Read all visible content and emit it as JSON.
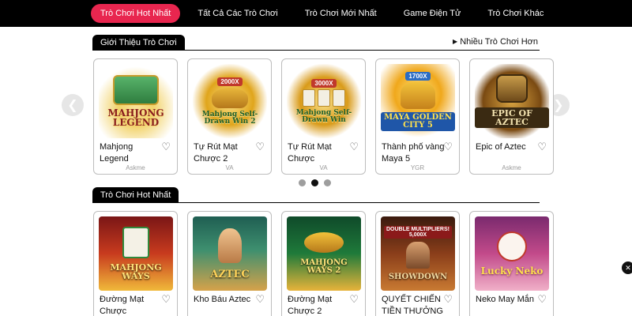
{
  "nav": {
    "items": [
      {
        "label": "Trò Chơi Hot Nhất",
        "active": true
      },
      {
        "label": "Tất Cả Các Trò Chơi",
        "active": false
      },
      {
        "label": "Trò Chơi Mới Nhất",
        "active": false
      },
      {
        "label": "Game Điện Tử",
        "active": false
      },
      {
        "label": "Trò Chơi Khác",
        "active": false
      }
    ]
  },
  "intro": {
    "title": "Giới Thiệu Trò Chơi",
    "more_label": "Nhiều Trò Chơi Hơn",
    "games": [
      {
        "name": "Mahjong Legend",
        "provider": "Askme",
        "art": "MAHJONG LEGEND"
      },
      {
        "name": "Tự Rút Mạt Chược 2",
        "provider": "VA",
        "art": "Mahjong Self-Drawn Win 2",
        "badge": "2000X"
      },
      {
        "name": "Tự Rút Mạt Chược",
        "provider": "VA",
        "art": "Mahjong Self-Drawn Win",
        "badge": "3000X"
      },
      {
        "name": "Thành phố vàng Maya 5",
        "provider": "YGR",
        "art": "MAYA GOLDEN CITY 5",
        "badge": "1700X"
      },
      {
        "name": "Epic of Aztec",
        "provider": "Askme",
        "art": "EPIC OF AZTEC"
      }
    ],
    "pagination": {
      "total": 3,
      "active": 2
    }
  },
  "hot": {
    "title": "Trò Chơi Hot Nhất",
    "games": [
      {
        "name": "Đường Mạt Chược",
        "art": "MAHJONG WAYS"
      },
      {
        "name": "Kho Báu Aztec",
        "art": "AZTEC"
      },
      {
        "name": "Đường Mạt Chược 2",
        "art": "MAHJONG WAYS 2"
      },
      {
        "name": "QUYẾT CHIẾN TIỀN THƯỞNG",
        "art": "SHOWDOWN",
        "badge": "DOUBLE MULTIPLIERS! 5,000X"
      },
      {
        "name": "Neko May Mắn",
        "art": "Lucky Neko"
      }
    ]
  },
  "icons": {
    "prev": "chevron-left-icon",
    "next": "chevron-right-icon",
    "heart": "heart-outline-icon",
    "more": "caret-right-icon"
  },
  "colors": {
    "accent": "#e8264f",
    "nav_bg": "#000000"
  }
}
